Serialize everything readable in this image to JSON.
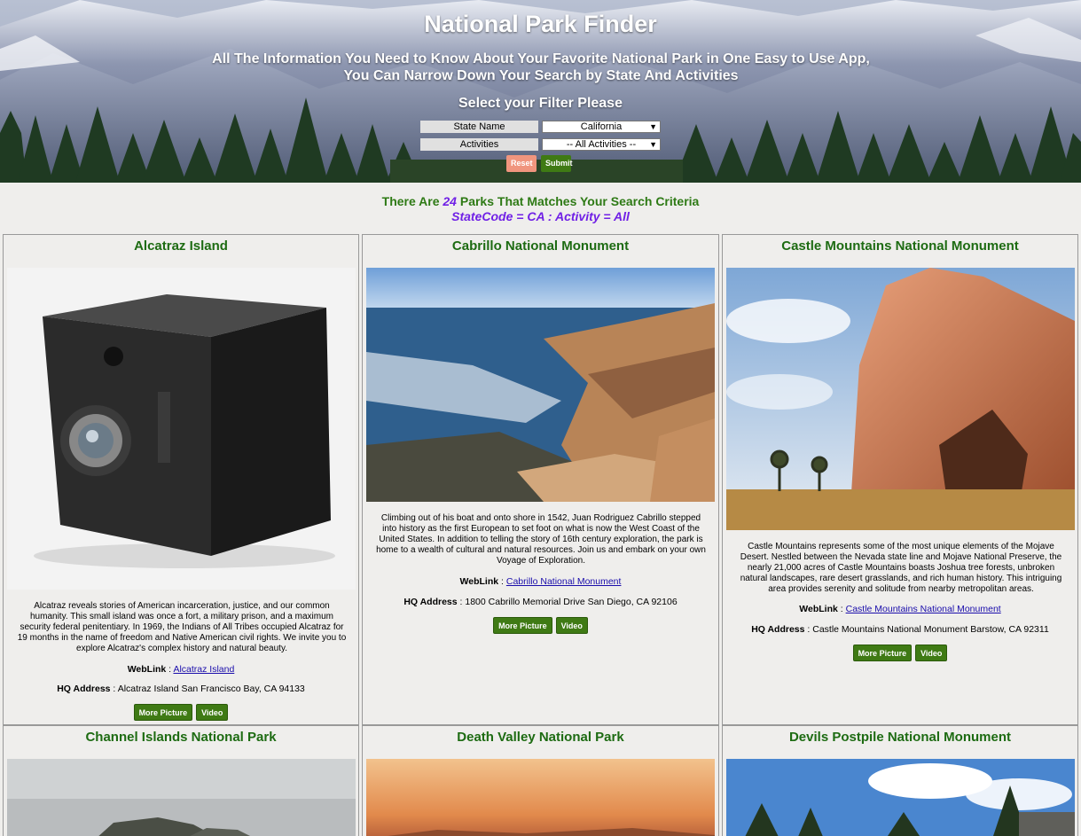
{
  "header": {
    "title": "National Park Finder",
    "subtitle": "All The Information You Need to Know About Your Favorite National Park in One Easy to Use App, You Can Narrow Down Your Search by State And Activities",
    "filter_prompt": "Select your Filter Please",
    "state_label": "State Name",
    "state_value": "California",
    "activities_label": "Activities",
    "activities_value": "-- All Activities --",
    "reset_label": "Reset",
    "submit_label": "Submit"
  },
  "summary": {
    "prefix": "There Are",
    "count": "24",
    "suffix": "Parks That Matches Your Search Criteria",
    "criteria": "StateCode = CA : Activity = All"
  },
  "labels": {
    "weblink": "WebLink",
    "hq_address": "HQ Address",
    "separator": " : ",
    "more_picture": "More Picture",
    "video": "Video"
  },
  "parks": [
    {
      "name": "Alcatraz Island",
      "description": "Alcatraz reveals stories of American incarceration, justice, and our common humanity. This small island was once a fort, a military prison, and a maximum security federal penitentiary. In 1969, the Indians of All Tribes occupied Alcatraz for 19 months in the name of freedom and Native American civil rights. We invite you to explore Alcatraz's complex history and natural beauty.",
      "weblink": "Alcatraz Island",
      "address": "Alcatraz Island San Francisco Bay, CA 94133",
      "image": "vintage-box-camera"
    },
    {
      "name": "Cabrillo National Monument",
      "description": "Climbing out of his boat and onto shore in 1542, Juan Rodriguez Cabrillo stepped into history as the first European to set foot on what is now the West Coast of the United States. In addition to telling the story of 16th century exploration, the park is home to a wealth of cultural and natural resources. Join us and embark on your own Voyage of Exploration.",
      "weblink": "Cabrillo National Monument",
      "address": "1800 Cabrillo Memorial Drive San Diego, CA 92106",
      "image": "rocky-coastline-tidepools"
    },
    {
      "name": "Castle Mountains National Monument",
      "description": "Castle Mountains represents some of the most unique elements of the Mojave Desert. Nestled between the Nevada state line and Mojave National Preserve, the nearly 21,000 acres of Castle Mountains boasts Joshua tree forests, unbroken natural landscapes, rare desert grasslands, and rich human history. This intriguing area provides serenity and solitude from nearby metropolitan areas.",
      "weblink": "Castle Mountains National Monument",
      "address": "Castle Mountains National Monument Barstow, CA 92311",
      "image": "desert-rock-formation"
    },
    {
      "name": "Channel Islands National Park",
      "image": "misty-islands"
    },
    {
      "name": "Death Valley National Park",
      "image": "desert-sunset"
    },
    {
      "name": "Devils Postpile National Monument",
      "image": "basalt-columns-forest"
    }
  ],
  "colors": {
    "page_bg": "#efeeec",
    "title_green": "#1d6b12",
    "accent_purple": "#7020e6",
    "button_green": "#3f7a14",
    "reset_orange": "#f0957e",
    "link_blue": "#1a0dab"
  }
}
